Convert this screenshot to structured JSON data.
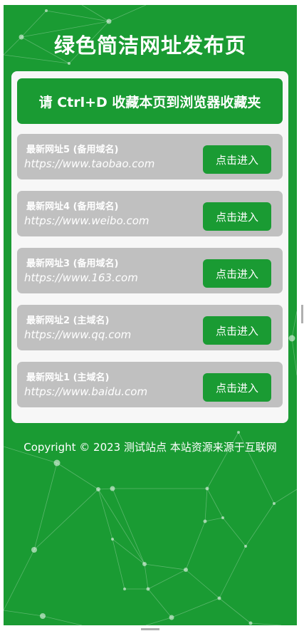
{
  "page": {
    "title": "绿色简洁网址发布页",
    "bookmark_hint": "请 Ctrl+D 收藏本页到浏览器收藏夹",
    "footer": "Copyright © 2023 测试站点 本站资源来源于互联网"
  },
  "links": [
    {
      "title": "最新网址5 (备用域名)",
      "url": "https://www.taobao.com",
      "button": "点击进入"
    },
    {
      "title": "最新网址4 (备用域名)",
      "url": "https://www.weibo.com",
      "button": "点击进入"
    },
    {
      "title": "最新网址3 (备用域名)",
      "url": "https://www.163.com",
      "button": "点击进入"
    },
    {
      "title": "最新网址2 (主域名)",
      "url": "https://www.qq.com",
      "button": "点击进入"
    },
    {
      "title": "最新网址1 (主域名)",
      "url": "https://www.baidu.com",
      "button": "点击进入"
    }
  ],
  "colors": {
    "brand_green": "#1a9b33",
    "row_gray": "#c0c0c0",
    "panel_bg": "#f7f7f7"
  }
}
